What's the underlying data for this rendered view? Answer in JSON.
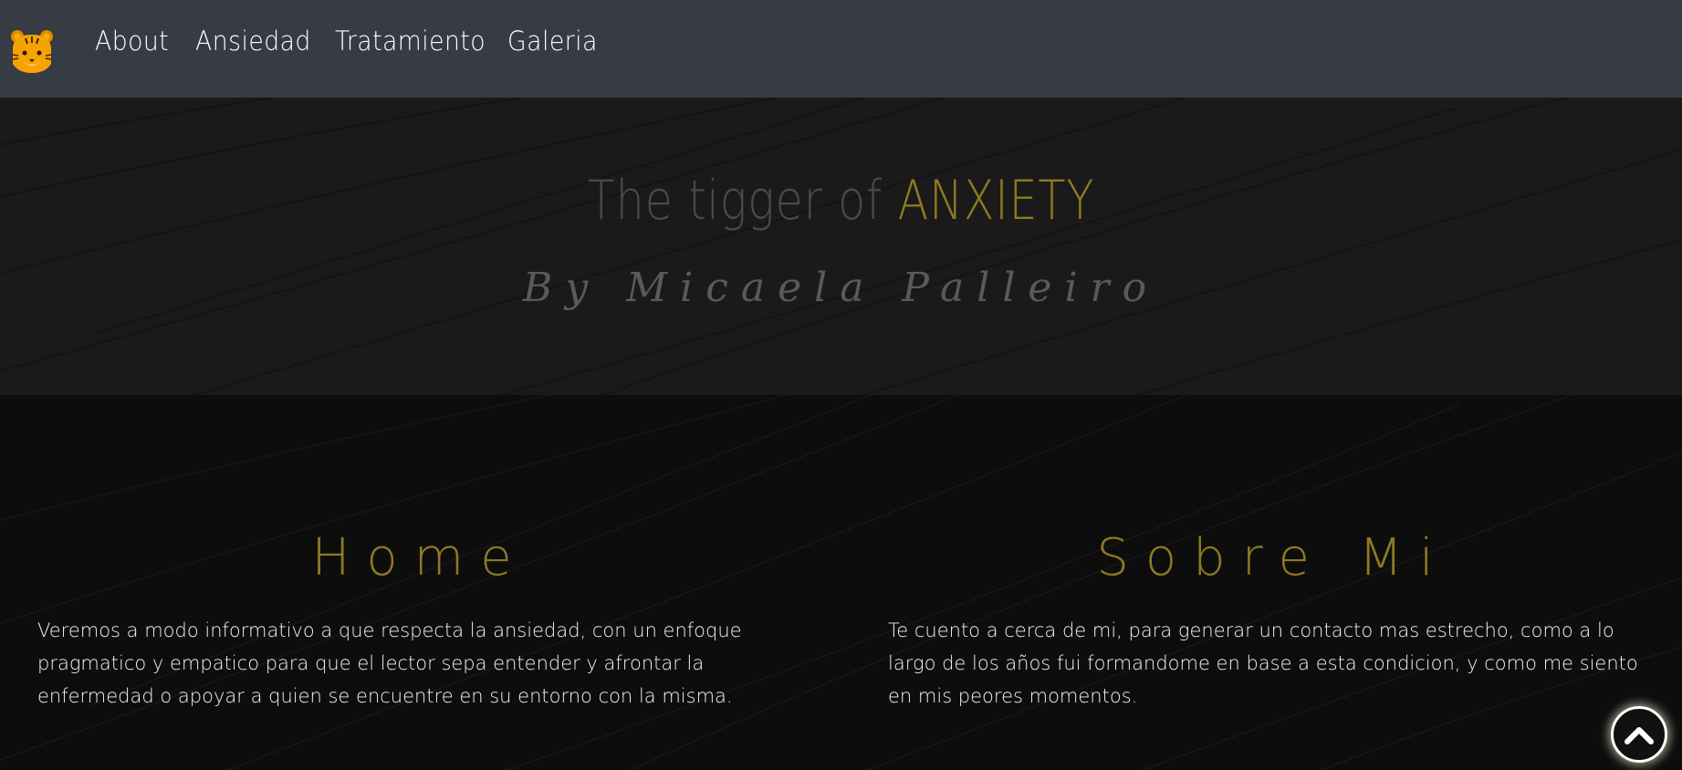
{
  "nav": {
    "links": [
      "About",
      "Ansiedad",
      "Tratamiento",
      "Galeria"
    ]
  },
  "hero": {
    "title_main": "The tigger of ",
    "title_accent": "ANXIETY",
    "subtitle": "By Micaela Palleiro"
  },
  "sections": [
    {
      "title": "Home",
      "text": "Veremos a modo informativo a que respecta la ansiedad, con un enfoque pragmatico y empatico para que el lector sepa entender y afrontar la enfermedad o apoyar a quien se encuentre en su entorno con la misma."
    },
    {
      "title": "Sobre Mi",
      "text": "Te cuento a cerca de mi, para generar un contacto mas estrecho, como a lo largo de los años fui formandome en base a esta condicion, y como me siento en mis peores momentos."
    }
  ],
  "icons": {
    "logo": "tiger-face-icon",
    "scroll_top": "chevron-up-icon"
  },
  "colors": {
    "navbar": "#363b44",
    "accent": "#8f7a1f",
    "hero_bg": "#1a1a1b",
    "content_bg": "#0d0d0e"
  }
}
